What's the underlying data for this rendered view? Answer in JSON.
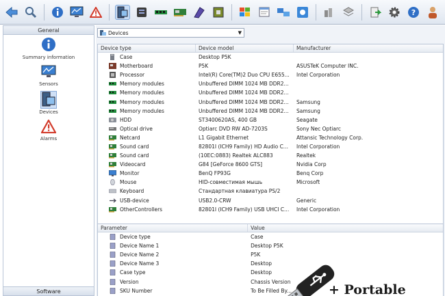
{
  "toolbar": {
    "icons": [
      "back-arrow-icon",
      "search-icon",
      "info-icon",
      "sensors-monitor-icon",
      "alarm-icon",
      "devices-icon",
      "motherboard-icon",
      "memory-icon",
      "card-icon",
      "drive-icon",
      "chip-icon",
      "windows-icon",
      "window-icon",
      "network-icon",
      "settings-icon",
      "help-icon",
      "user-icon"
    ]
  },
  "sidebar": {
    "group_label": "General",
    "items": [
      {
        "label": "Summary information",
        "icon": "info-icon"
      },
      {
        "label": "Sensors",
        "icon": "sensors-monitor-icon"
      },
      {
        "label": "Devices",
        "icon": "devices-icon",
        "selected": true
      },
      {
        "label": "Alarms",
        "icon": "alarm-icon"
      }
    ],
    "software_label": "Software"
  },
  "dropdown": {
    "value": "Devices"
  },
  "devices_table": {
    "headers": [
      "Device type",
      "Device model",
      "Manufacturer"
    ],
    "rows": [
      {
        "type": "Case",
        "model": "Desktop P5K",
        "mfr": "",
        "icon": "case-icon"
      },
      {
        "type": "Motherboard",
        "model": "P5K",
        "mfr": "ASUSTeK Computer INC.",
        "icon": "motherboard-icon"
      },
      {
        "type": "Processor",
        "model": "Intel(R) Core(TM)2 Duo CPU E655...",
        "mfr": "Intel Corporation",
        "icon": "processor-icon"
      },
      {
        "type": "Memory modules",
        "model": "Unbuffered DIMM 1024 MB DDR2...",
        "mfr": "",
        "icon": "memory-icon"
      },
      {
        "type": "Memory modules",
        "model": "Unbuffered DIMM 1024 MB DDR2...",
        "mfr": "",
        "icon": "memory-icon"
      },
      {
        "type": "Memory modules",
        "model": "Unbuffered DIMM 1024 MB DDR2...",
        "mfr": "Samsung",
        "icon": "memory-icon"
      },
      {
        "type": "Memory modules",
        "model": "Unbuffered DIMM 1024 MB DDR2...",
        "mfr": "Samsung",
        "icon": "memory-icon"
      },
      {
        "type": "HDD",
        "model": "ST3400620AS, 400 GB",
        "mfr": "Seagate",
        "icon": "hdd-icon"
      },
      {
        "type": "Optical drive",
        "model": "Optiarc DVD RW AD-7203S",
        "mfr": "Sony Nec Optiarc",
        "icon": "optical-drive-icon"
      },
      {
        "type": "Netcard",
        "model": "L1 Gigabit Ethernet",
        "mfr": "Attansic Technology Corp.",
        "icon": "card-icon"
      },
      {
        "type": "Sound card",
        "model": "82801I (ICH9 Family) HD Audio C...",
        "mfr": "Intel Corporation",
        "icon": "card-icon"
      },
      {
        "type": "Sound card",
        "model": "(10EC:0883) Realtek ALC883",
        "mfr": "Realtek",
        "icon": "card-icon"
      },
      {
        "type": "Videocard",
        "model": "G84 [GeForce 8600 GTS]",
        "mfr": "Nvidia Corp",
        "icon": "card-icon"
      },
      {
        "type": "Monitor",
        "model": "BenQ FP93G",
        "mfr": "Benq Corp",
        "icon": "monitor-icon"
      },
      {
        "type": "Mouse",
        "model": "HID-совместимая мышь",
        "mfr": "Microsoft",
        "icon": "mouse-icon"
      },
      {
        "type": "Keyboard",
        "model": "Стандартная клавиатура PS/2",
        "mfr": "",
        "icon": "keyboard-icon"
      },
      {
        "type": "USB-device",
        "model": "USB2.0-CRW",
        "mfr": "Generic",
        "icon": "usb-icon"
      },
      {
        "type": "OtherControllers",
        "model": "82801I (ICH9 Family) USB UHCI C...",
        "mfr": "Intel Corporation",
        "icon": "card-icon"
      }
    ]
  },
  "props_table": {
    "headers": [
      "Parameter",
      "Value"
    ],
    "rows": [
      {
        "param": "Device type",
        "value": "Case"
      },
      {
        "param": "Device Name 1",
        "value": "Desktop P5K"
      },
      {
        "param": "Device Name 2",
        "value": "P5K"
      },
      {
        "param": "Device Name 3",
        "value": "Desktop"
      },
      {
        "param": "Case type",
        "value": "Desktop"
      },
      {
        "param": "Version",
        "value": "Chassis Version"
      },
      {
        "param": "SKU Number",
        "value": "To Be Filled By..."
      }
    ]
  },
  "overlay": {
    "text": "+ Portable"
  },
  "colors": {
    "accent": "#2f6fc6",
    "selection": "#cfe0f6",
    "alarm": "#d23a2a",
    "memory": "#1f8a3a"
  }
}
